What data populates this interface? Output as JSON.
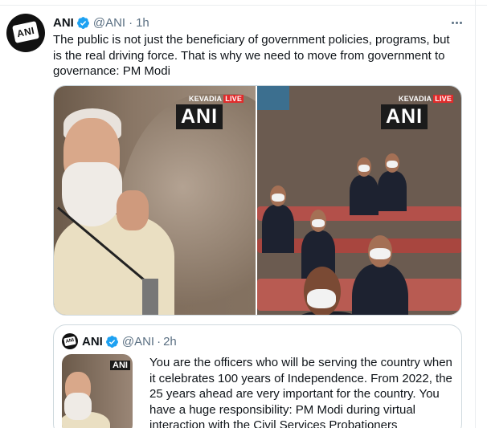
{
  "tweet": {
    "author_name": "ANI",
    "handle": "@ANI",
    "separator": "·",
    "time": "1h",
    "text": "The public is not just the beneficiary of government policies, programs, but is the real driving force. That is why we need to move from government to governance: PM Modi",
    "media": {
      "left": {
        "watermark_place": "KEVADIA",
        "watermark_live": "LIVE",
        "watermark_logo": "ANI"
      },
      "right": {
        "watermark_place": "KEVADIA",
        "watermark_live": "LIVE",
        "watermark_logo": "ANI"
      }
    }
  },
  "quote": {
    "author_name": "ANI",
    "handle": "@ANI",
    "separator": "·",
    "time": "2h",
    "thumb_logo": "ANI",
    "text": "You are the officers who will be serving the country when it celebrates 100 years of Independence. From 2022, the 25 years ahead are very important for the country. You have a huge responsibility: PM Modi during virtual interaction with the Civil Services Probationers"
  },
  "avatar_logo": "ANI",
  "icons": {
    "verified": "verified-badge-icon",
    "more": "more-options-icon"
  },
  "colors": {
    "accent": "#1da1f2",
    "secondary_text": "#5b7083",
    "border": "#cfd9de",
    "live_red": "#e12b2b"
  }
}
